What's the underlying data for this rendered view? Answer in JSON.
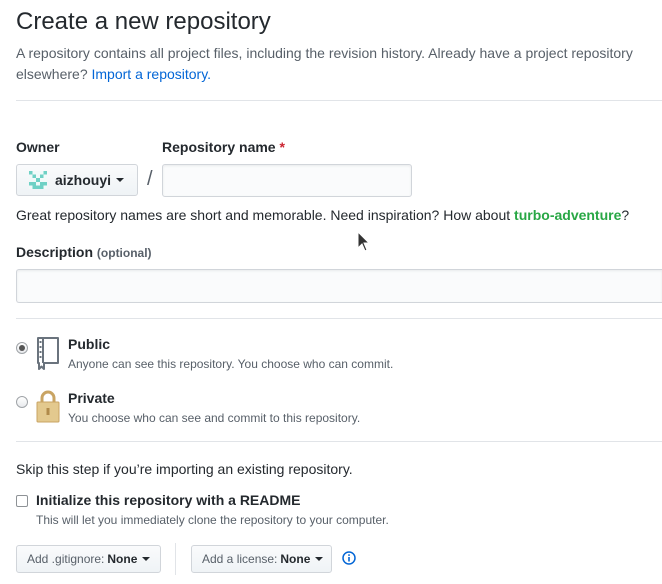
{
  "header": {
    "title": "Create a new repository",
    "subtitle": "A repository contains all project files, including the revision history. Already have a project repository elsewhere?",
    "import_link": "Import a repository."
  },
  "owner": {
    "label": "Owner",
    "value": "aizhouyi"
  },
  "repo_name": {
    "label": "Repository name",
    "required_mark": "*",
    "value": "",
    "separator": "/"
  },
  "hint": {
    "text": "Great repository names are short and memorable. Need inspiration? How about",
    "suggestion": "turbo-adventure",
    "suffix": "?"
  },
  "description": {
    "label": "Description",
    "optional": "(optional)",
    "value": ""
  },
  "visibility": {
    "options": [
      {
        "title": "Public",
        "desc": "Anyone can see this repository. You choose who can commit.",
        "selected": true,
        "icon": "repo-book-icon"
      },
      {
        "title": "Private",
        "desc": "You choose who can see and commit to this repository.",
        "selected": false,
        "icon": "lock-icon"
      }
    ]
  },
  "init": {
    "skip_text": "Skip this step if you’re importing an existing repository.",
    "readme_label": "Initialize this repository with a README",
    "readme_desc": "This will let you immediately clone the repository to your computer.",
    "readme_checked": false
  },
  "gitignore": {
    "label": "Add .gitignore:",
    "value": "None"
  },
  "license": {
    "label": "Add a license:",
    "value": "None"
  },
  "colors": {
    "link": "#0366d6",
    "suggestion": "#28a745",
    "required": "#cb2431",
    "text": "#24292e",
    "muted": "#586069"
  }
}
